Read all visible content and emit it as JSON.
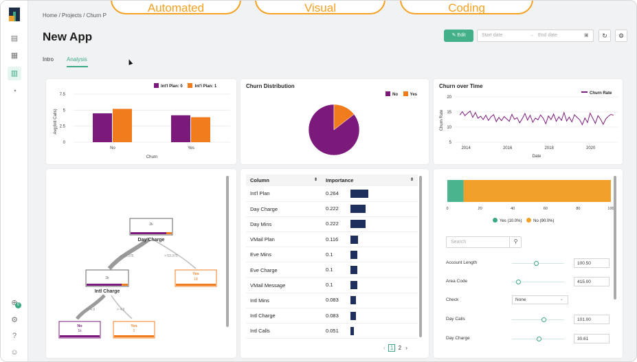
{
  "breadcrumb": "Home / Projects / Churn P",
  "page_title": "New App",
  "tabs": [
    "Intro",
    "Analysis"
  ],
  "toolbar": {
    "edit_label": "Edit",
    "start_placeholder": "Start date",
    "end_placeholder": "End date",
    "arrow": "→"
  },
  "overlay_labels": [
    "Automated",
    "Visual",
    "Coding"
  ],
  "sidebar_badge": "0",
  "colors": {
    "accent": "#3aa884",
    "purple": "#7b1a7b",
    "orange": "#f07c1e",
    "navy": "#1e2f5e",
    "yellow": "#f0a028"
  },
  "bar_chart": {
    "chart_data": {
      "type": "bar",
      "categories": [
        "No",
        "Yes"
      ],
      "series": [
        {
          "name": "Int'l Plan: 0",
          "values": [
            4.5,
            4.2
          ]
        },
        {
          "name": "Int'l Plan: 1",
          "values": [
            5.2,
            3.9
          ]
        }
      ],
      "xlabel": "Churn",
      "ylabel": "Avg(Intl Calls)",
      "ylim": [
        0,
        7.5
      ],
      "yticks": [
        "7.5",
        "5",
        "2.5",
        "0"
      ],
      "legend": "top-right"
    }
  },
  "pie_chart": {
    "title": "Churn Distribution",
    "chart_data": {
      "type": "pie",
      "categories": [
        "No",
        "Yes"
      ],
      "values": [
        85.5,
        14.5
      ],
      "legend": "top-right"
    }
  },
  "line_chart": {
    "title": "Churn over Time",
    "chart_data": {
      "type": "line",
      "series": [
        {
          "name": "Churn Rate"
        }
      ],
      "xlabel": "Date",
      "ylabel": "Churn Rate",
      "xticks": [
        "2014",
        "2016",
        "2018",
        "2020"
      ],
      "yticks": [
        "20",
        "15",
        "10",
        "5"
      ],
      "x_range": [
        2013.5,
        2021.3
      ],
      "ylim": [
        5,
        20
      ],
      "values": [
        14,
        15.1,
        13.8,
        14.6,
        15.3,
        13.2,
        14.8,
        12.9,
        13.6,
        12.5,
        13.9,
        12.2,
        13.4,
        14.1,
        11.8,
        13.2,
        12.1,
        13.5,
        12.7,
        11.9,
        14.2,
        12.6,
        13.1,
        11.4,
        12.8,
        14.5,
        12.3,
        13.9,
        11.6,
        13.0,
        12.4,
        14.0,
        12.9,
        11.1,
        13.7,
        12.5,
        14.3,
        11.9,
        13.4,
        12.2,
        14.8,
        12.0,
        13.3,
        11.7,
        14.1,
        13.2,
        12.4,
        10.8,
        13.0,
        11.5,
        14.6,
        12.9,
        11.2,
        13.8,
        12.6,
        10.9,
        12.7,
        13.6,
        14.2,
        13.9
      ]
    }
  },
  "tree": {
    "root": {
      "count": "2k",
      "label": "Day Charge"
    },
    "left_edge": "≤ 53.375",
    "right_edge": "> 53.375",
    "mid": {
      "count": "1k",
      "label": "Intl Charge"
    },
    "yes_node": {
      "label": "Yes",
      "count": "18"
    },
    "ll_edge": "≤ 4.9",
    "lr_edge": "> 4.9",
    "no_leaf": {
      "label": "No",
      "count": "1k"
    },
    "yes_leaf": {
      "label": "Yes",
      "count": "2"
    }
  },
  "importance": {
    "headers": [
      "Column",
      "Importance"
    ],
    "rows": [
      {
        "col": "Int'l Plan",
        "val": "0.264",
        "frac": 0.264
      },
      {
        "col": "Day Charge",
        "val": "0.222",
        "frac": 0.222
      },
      {
        "col": "Day Mins",
        "val": "0.222",
        "frac": 0.222
      },
      {
        "col": "VMail Plan",
        "val": "0.116",
        "frac": 0.116
      },
      {
        "col": "Eve Mins",
        "val": "0.1",
        "frac": 0.1
      },
      {
        "col": "Eve Charge",
        "val": "0.1",
        "frac": 0.1
      },
      {
        "col": "VMail Message",
        "val": "0.1",
        "frac": 0.1
      },
      {
        "col": "Intl Mins",
        "val": "0.083",
        "frac": 0.083
      },
      {
        "col": "Intl Charge",
        "val": "0.083",
        "frac": 0.083
      },
      {
        "col": "Intl Calls",
        "val": "0.051",
        "frac": 0.051
      }
    ],
    "pages": [
      "1",
      "2"
    ],
    "prev": "‹",
    "next": "›"
  },
  "predict": {
    "chart_data": {
      "type": "bar",
      "categories": [
        "Yes",
        "No"
      ],
      "values": [
        10.0,
        90.0
      ],
      "xticks": [
        "0",
        "20",
        "40",
        "60",
        "80",
        "100"
      ]
    },
    "legend_yes": "Yes (10.0%)",
    "legend_no": "No (90.0%)",
    "search_placeholder": "Search",
    "fields": [
      {
        "label": "Account Length",
        "value": "100.50",
        "level": 0.45
      },
      {
        "label": "Area Code",
        "value": "415.00",
        "level": 0.08
      },
      {
        "label": "Check",
        "value": "None"
      },
      {
        "label": "Day Calls",
        "value": "101.00",
        "level": 0.62
      },
      {
        "label": "Day Charge",
        "value": "30.61",
        "level": 0.52
      }
    ]
  }
}
